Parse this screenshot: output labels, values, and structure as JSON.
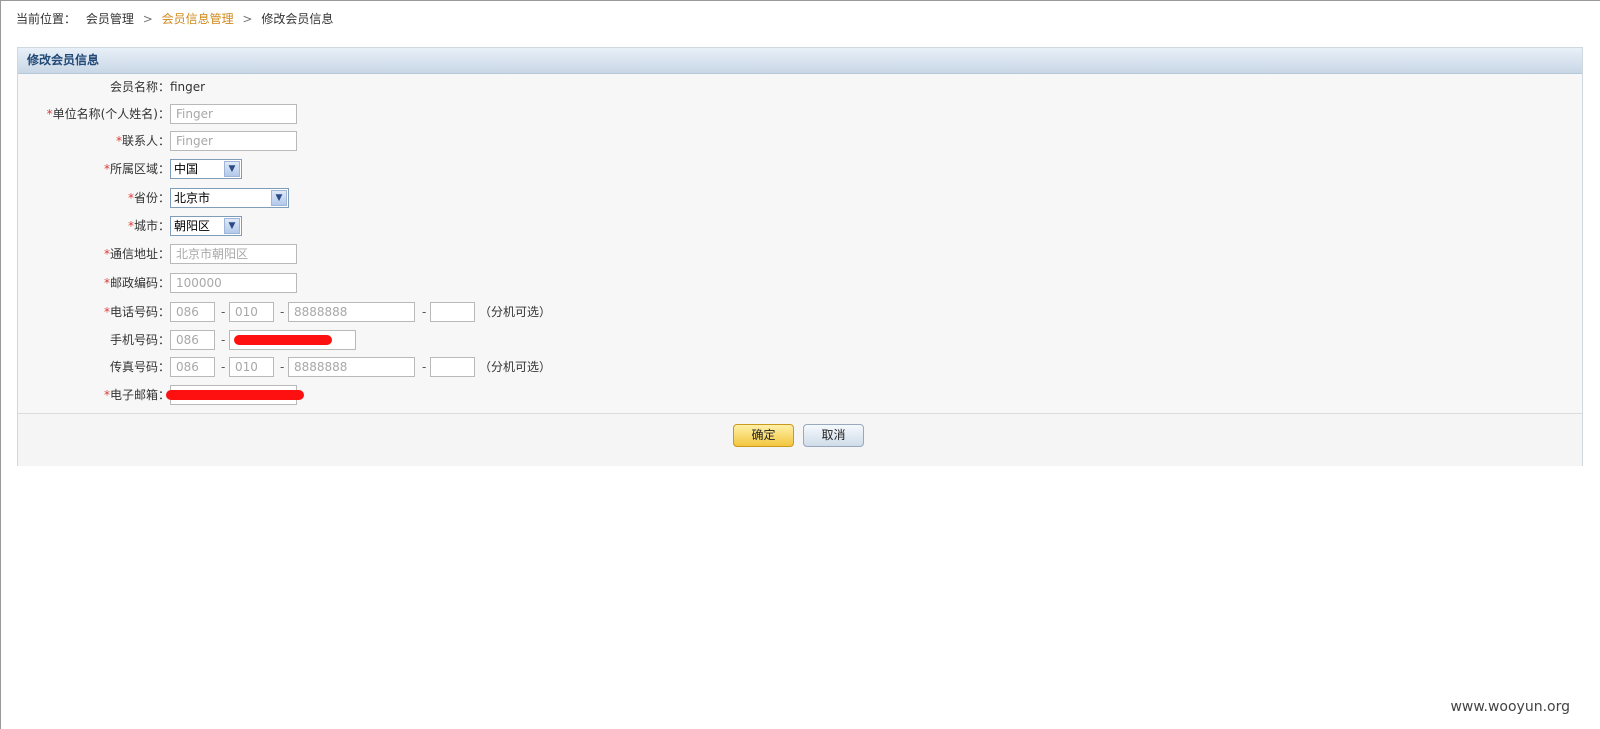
{
  "breadcrumb": {
    "label": "当前位置：",
    "items": [
      "会员管理",
      "会员信息管理",
      "修改会员信息"
    ],
    "separator": ">"
  },
  "panel": {
    "title": "修改会员信息"
  },
  "form": {
    "required_mark": "*",
    "member_name": {
      "label": "会员名称：",
      "value": "finger"
    },
    "company": {
      "label": "单位名称(个人姓名)：",
      "placeholder": "Finger"
    },
    "contact": {
      "label": "联系人：",
      "placeholder": "Finger"
    },
    "region": {
      "label": "所属区域：",
      "selected": "中国"
    },
    "province": {
      "label": "省份：",
      "selected": "北京市"
    },
    "city": {
      "label": "城市：",
      "selected": "朝阳区"
    },
    "address": {
      "label": "通信地址：",
      "placeholder": "北京市朝阳区"
    },
    "postcode": {
      "label": "邮政编码：",
      "placeholder": "100000"
    },
    "phone": {
      "label": "电话号码：",
      "country": "086",
      "area": "010",
      "number": "8888888",
      "hint": "（分机可选）"
    },
    "mobile": {
      "label": "手机号码：",
      "country": "086"
    },
    "fax": {
      "label": "传真号码：",
      "country": "086",
      "area": "010",
      "number": "8888888",
      "hint": "（分机可选）"
    },
    "email": {
      "label": "电子邮箱："
    },
    "dash": "-"
  },
  "buttons": {
    "ok": "确定",
    "cancel": "取消"
  },
  "watermark": "www.wooyun.org",
  "colors": {
    "accent_breadcrumb": "#d08a1c",
    "required": "#e03a3a",
    "header_text": "#234a77"
  }
}
